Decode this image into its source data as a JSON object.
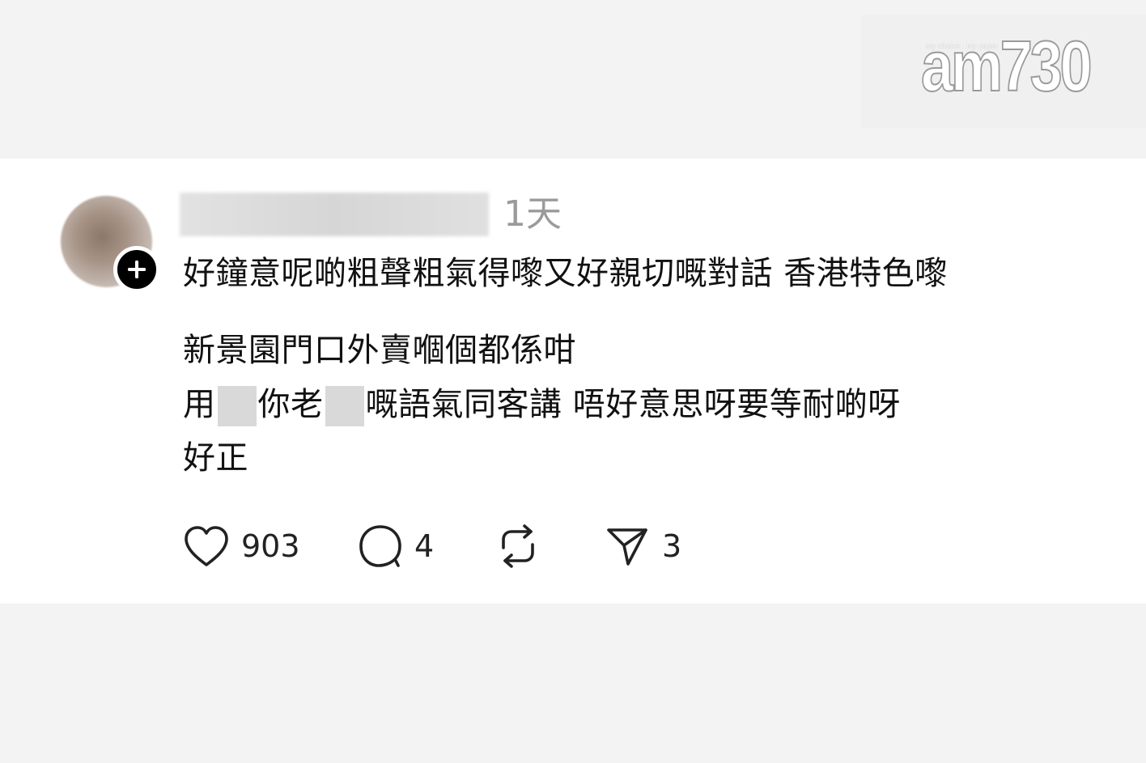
{
  "watermark": {
    "tagline": "my choice . my paper",
    "logo": "am730"
  },
  "post": {
    "timestamp": "1天",
    "lines": [
      "好鐘意呢啲粗聲粗氣得嚟又好親切嘅對話 香港特色嚟",
      "新景園門口外賣嗰個都係咁",
      "好正"
    ],
    "line_redacted": {
      "part1": "用",
      "part2": "你老",
      "part3": "嘅語氣同客講 唔好意思呀要等耐啲呀"
    },
    "actions": {
      "like_count": "903",
      "reply_count": "4",
      "repost_count": "",
      "share_count": "3"
    }
  },
  "icons": {
    "follow": "plus-icon",
    "like": "heart-icon",
    "reply": "speech-bubble-icon",
    "repost": "repost-icon",
    "share": "send-icon"
  },
  "colors": {
    "page_background": "#f3f3f3",
    "card_background": "#ffffff",
    "text": "#111111",
    "muted": "#9a9a9a",
    "badge": "#000000"
  }
}
